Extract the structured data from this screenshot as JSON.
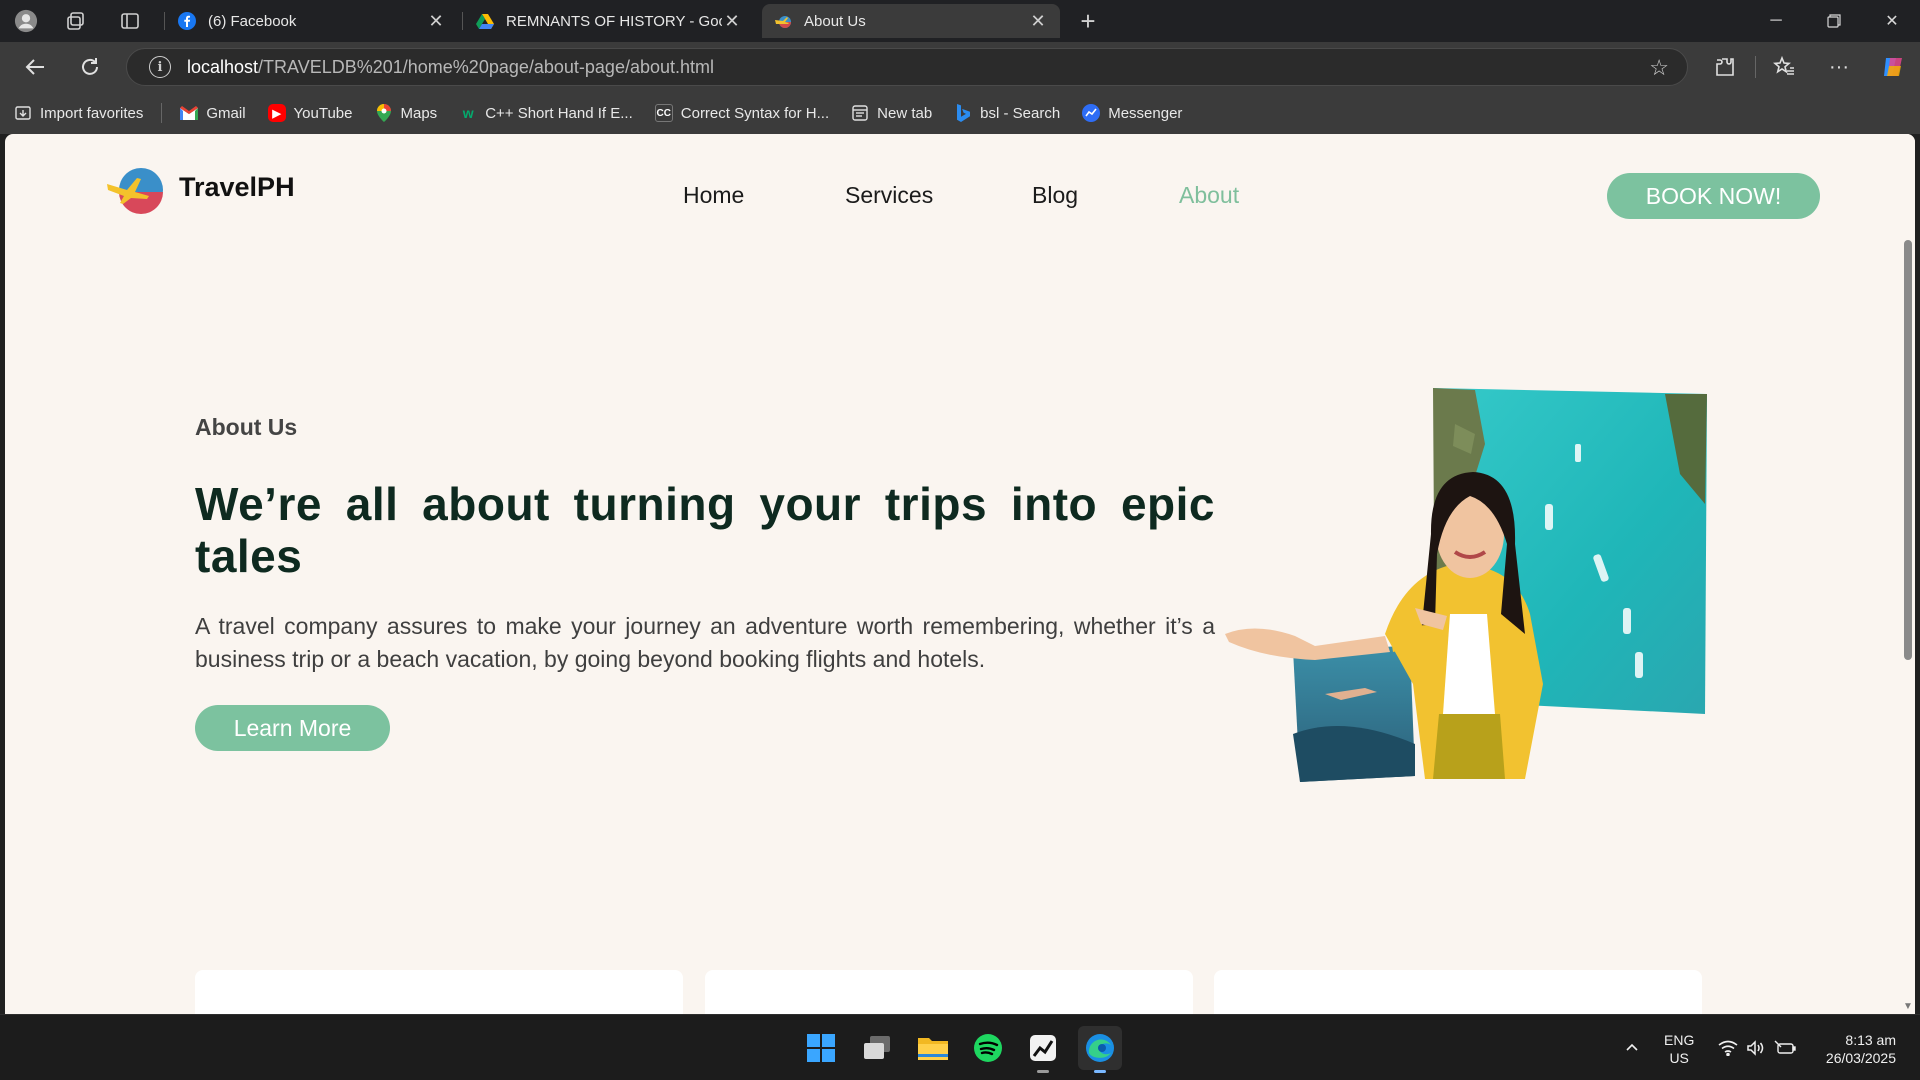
{
  "browser": {
    "tabs": [
      {
        "title": "(6) Facebook",
        "icon": "facebook-icon",
        "active": false
      },
      {
        "title": "REMNANTS OF HISTORY - Google Drive",
        "icon": "google-drive-icon",
        "active": false
      },
      {
        "title": "About Us",
        "icon": "travelph-favicon",
        "active": true
      }
    ],
    "address": {
      "host": "localhost",
      "path": "/TRAVELDB%201/home%20page/about-page/about.html"
    },
    "bookmarks": [
      {
        "label": "Import favorites",
        "icon": "import-icon"
      },
      {
        "label": "Gmail",
        "icon": "gmail-icon"
      },
      {
        "label": "YouTube",
        "icon": "youtube-icon"
      },
      {
        "label": "Maps",
        "icon": "maps-icon"
      },
      {
        "label": "C++ Short Hand If E...",
        "icon": "w3schools-icon"
      },
      {
        "label": "Correct Syntax for H...",
        "icon": "cc-icon"
      },
      {
        "label": "New tab",
        "icon": "newtab-icon"
      },
      {
        "label": "bsl - Search",
        "icon": "bing-icon"
      },
      {
        "label": "Messenger",
        "icon": "messenger-icon"
      }
    ]
  },
  "site": {
    "brand": "TravelPH",
    "nav": [
      {
        "label": "Home",
        "active": false
      },
      {
        "label": "Services",
        "active": false
      },
      {
        "label": "Blog",
        "active": false
      },
      {
        "label": "About",
        "active": true
      }
    ],
    "cta": "BOOK NOW!",
    "accent_color": "#7cc29f"
  },
  "hero": {
    "eyebrow": "About Us",
    "headline": "We’re all about turning your trips into epic tales",
    "description": "A travel company assures to make your journey an adventure worth remembering, whether it’s a business trip or a beach vacation, by going beyond booking flights and hotels.",
    "button": "Learn More"
  },
  "taskbar": {
    "language": "ENG",
    "region": "US",
    "time": "8:13 am",
    "date": "26/03/2025"
  }
}
